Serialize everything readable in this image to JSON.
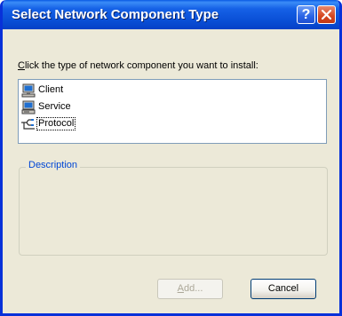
{
  "window": {
    "title": "Select Network Component Type",
    "help_label": "?",
    "colors": {
      "titlebar": "#0a4fd6",
      "frame": "#0831d9",
      "face": "#ece9d8",
      "groupLabel": "#0046d5"
    }
  },
  "prompt": {
    "accel": "C",
    "rest": "lick the type of network component you want to install:"
  },
  "components": [
    {
      "label": "Client",
      "icon": "client-computer-icon"
    },
    {
      "label": "Service",
      "icon": "service-computer-icon"
    },
    {
      "label": "Protocol",
      "icon": "protocol-cable-icon",
      "selected": true
    }
  ],
  "description": {
    "label": "Description",
    "text": ""
  },
  "buttons": {
    "add": {
      "accel": "A",
      "rest": "dd...",
      "enabled": false
    },
    "cancel": {
      "label": "Cancel"
    }
  }
}
